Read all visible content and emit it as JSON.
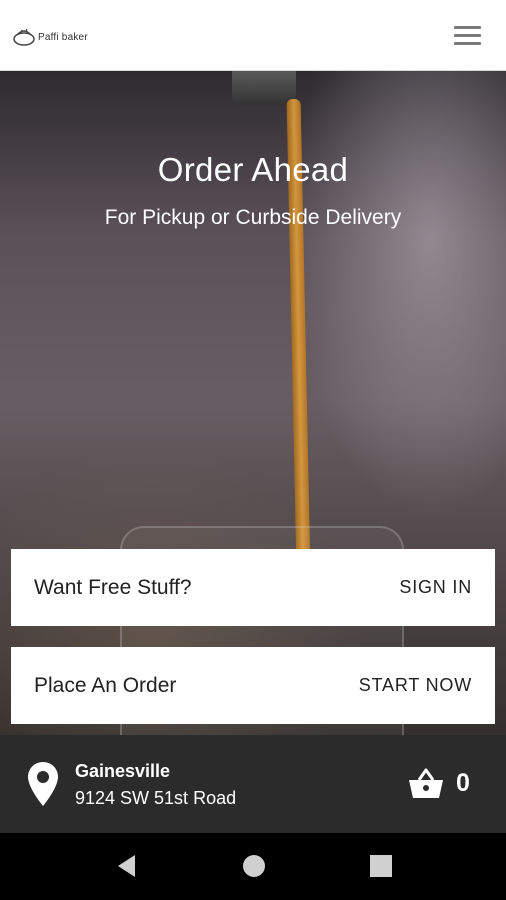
{
  "header": {
    "logo_text": "Paffi baker",
    "icons": {
      "logo": "logo-mark-icon",
      "menu": "hamburger-menu-icon"
    }
  },
  "hero": {
    "title": "Order Ahead",
    "subtitle": "For Pickup or Curbside Delivery"
  },
  "cards": [
    {
      "label": "Want Free Stuff?",
      "action": "SIGN IN"
    },
    {
      "label": "Place An Order",
      "action": "START NOW"
    }
  ],
  "location": {
    "city": "Gainesville",
    "address": "9124 SW 51st Road",
    "icon": "map-pin-icon"
  },
  "cart": {
    "count": "0",
    "icon": "basket-icon"
  },
  "system_nav": {
    "back": "back-icon",
    "home": "home-icon",
    "recents": "recents-icon"
  },
  "colors": {
    "header_bg": "#ffffff",
    "card_bg": "#ffffff",
    "location_bar_bg": "#2b2b2b",
    "nav_bar_bg": "#000000",
    "text_on_dark": "#ffffff"
  }
}
